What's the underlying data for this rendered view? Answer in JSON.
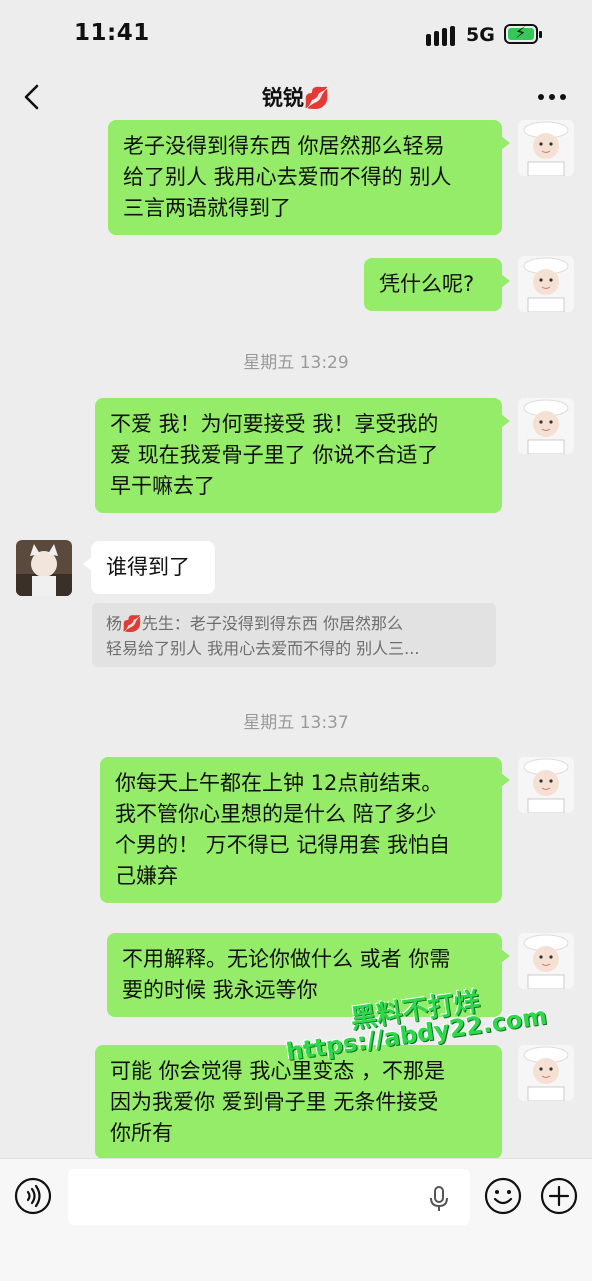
{
  "status_bar": {
    "time": "11:41",
    "network": "5G"
  },
  "nav": {
    "title": "锐锐💋"
  },
  "messages": [
    {
      "side": "right",
      "lines": [
        "老子没得到得东西 你居然那么轻易",
        "给了别人 我用心去爱而不得的 别人",
        "三言两语就得到了"
      ]
    },
    {
      "side": "right",
      "lines": [
        "凭什么呢?"
      ]
    },
    {
      "type": "time",
      "text": "星期五 13:29"
    },
    {
      "side": "right",
      "lines": [
        "不爱 我！为何要接受 我！享受我的",
        "爱  现在我爱骨子里了 你说不合适了",
        "早干嘛去了"
      ]
    },
    {
      "side": "left",
      "lines": [
        "谁得到了"
      ],
      "quote": [
        "杨💋先生：老子没得到得东西 你居然那么",
        "轻易给了别人 我用心去爱而不得的 别人三..."
      ]
    },
    {
      "type": "time",
      "text": "星期五 13:37"
    },
    {
      "side": "right",
      "lines": [
        "你每天上午都在上钟 12点前结束。",
        "我不管你心里想的是什么 陪了多少",
        "个男的！ 万不得已 记得用套 我怕自",
        "己嫌弃"
      ]
    },
    {
      "side": "right",
      "lines": [
        "不用解释。无论你做什么 或者 你需",
        "要的时候 我永远等你"
      ]
    },
    {
      "side": "right",
      "lines": [
        "可能 你会觉得 我心里变态 ，不那是",
        "因为我爱你 爱到骨子里 无条件接受",
        "你所有"
      ]
    }
  ],
  "watermark": {
    "line1": "黑料不打烊",
    "line2": "https://abdy22.com"
  },
  "input": {
    "placeholder": ""
  },
  "colors": {
    "bubble_self": "#95ec69",
    "bubble_other": "#ffffff",
    "background": "#ededed"
  }
}
